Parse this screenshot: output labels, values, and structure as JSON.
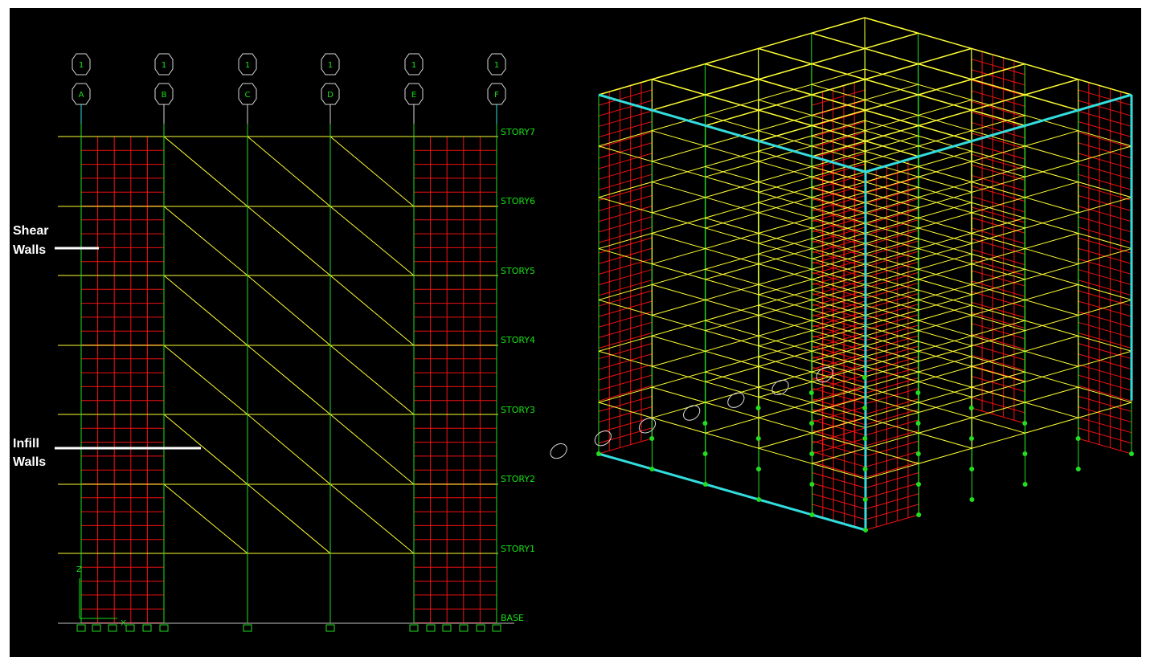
{
  "elevation": {
    "grid_bubbles": [
      {
        "top": "1",
        "bottom": "A"
      },
      {
        "top": "1",
        "bottom": "B"
      },
      {
        "top": "1",
        "bottom": "C"
      },
      {
        "top": "1",
        "bottom": "D"
      },
      {
        "top": "1",
        "bottom": "E"
      },
      {
        "top": "1",
        "bottom": "F"
      }
    ],
    "story_labels": [
      "STORY7",
      "STORY6",
      "STORY5",
      "STORY4",
      "STORY3",
      "STORY2",
      "STORY1",
      "BASE"
    ],
    "annotations": {
      "shear_line1": "Shear",
      "shear_line2": "Walls",
      "infill_line1": "Infill",
      "infill_line2": "Walls"
    },
    "axis": {
      "z": "Z",
      "x": "X"
    }
  },
  "colors": {
    "background": "#000000",
    "frame_yellow": "#ffff33",
    "column_green": "#22dd22",
    "wall_red": "#ee1111",
    "highlight_cyan": "#33dddd",
    "annotation_white": "#ffffff"
  }
}
